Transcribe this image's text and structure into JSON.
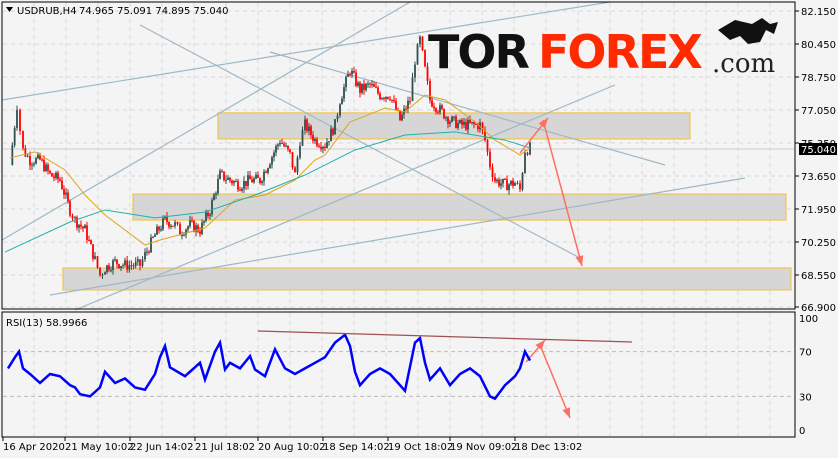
{
  "header": {
    "symbol_label": "USDRUB,H4",
    "ohlc": "74.965 75.091 74.895 75.040"
  },
  "logo": {
    "part1": "TOR",
    "part2": "FOREX",
    "part3": ".com"
  },
  "colors": {
    "bull_candle": "#2f4f4f",
    "bear_candle": "#ff0000",
    "ma_fast": "#daa520",
    "ma_slow": "#20b2aa",
    "zone_fill": "#d3d3d3",
    "zone_border": "#f0c040",
    "trendline": "#9fb8c8",
    "arrow": "#ff6f61",
    "rsi_line": "#0000ff",
    "rsi_trend": "#a05050"
  },
  "chart_data": [
    {
      "type": "candlestick",
      "title": "USDRUB,H4",
      "ylim": [
        66.9,
        82.15
      ],
      "y_ticks": [
        "82.150",
        "80.450",
        "78.750",
        "77.050",
        "75.350",
        "73.650",
        "71.950",
        "70.250",
        "68.550",
        "66.900"
      ],
      "current_price": "75.040",
      "x_ticks": [
        "16 Apr 2020",
        "21 May 10:02",
        "22 Jun 14:02",
        "21 Jul 18:02",
        "20 Aug 10:02",
        "18 Sep 14:02",
        "19 Oct 18:02",
        "19 Nov 09:02",
        "18 Dec 13:02"
      ],
      "close_series": [
        [
          1,
          74.22
        ],
        [
          2.4,
          77.31
        ],
        [
          3,
          76.02
        ],
        [
          3.6,
          74.99
        ],
        [
          5,
          74.47
        ],
        [
          7,
          74.47
        ],
        [
          9,
          73.7
        ],
        [
          11,
          73.44
        ],
        [
          13,
          71.9
        ],
        [
          14,
          71.38
        ],
        [
          16,
          70.87
        ],
        [
          18,
          69.32
        ],
        [
          19,
          68.55
        ],
        [
          20,
          68.91
        ],
        [
          22,
          69.22
        ],
        [
          24,
          69.06
        ],
        [
          27,
          69.06
        ],
        [
          28,
          69.58
        ],
        [
          30,
          70.61
        ],
        [
          32,
          71.38
        ],
        [
          34,
          71.13
        ],
        [
          35,
          70.76
        ],
        [
          37,
          71.13
        ],
        [
          39,
          70.87
        ],
        [
          41,
          71.9
        ],
        [
          43,
          73.7
        ],
        [
          45,
          73.44
        ],
        [
          47,
          73.19
        ],
        [
          49,
          73.44
        ],
        [
          51,
          73.44
        ],
        [
          53,
          74.47
        ],
        [
          55,
          75.5
        ],
        [
          57,
          74.73
        ],
        [
          58,
          73.7
        ],
        [
          59,
          75.5
        ],
        [
          60,
          76.28
        ],
        [
          62,
          75.5
        ],
        [
          64,
          75.25
        ],
        [
          66,
          76.28
        ],
        [
          67,
          77.57
        ],
        [
          69,
          79.11
        ],
        [
          71,
          78.08
        ],
        [
          73,
          78.34
        ],
        [
          75,
          77.82
        ],
        [
          77,
          77.82
        ],
        [
          79,
          76.53
        ],
        [
          81,
          77.57
        ],
        [
          82,
          79.63
        ],
        [
          83,
          80.66
        ],
        [
          84,
          79.11
        ],
        [
          85,
          77.57
        ],
        [
          87,
          77.05
        ],
        [
          89,
          76.53
        ],
        [
          91,
          76.28
        ],
        [
          93,
          76.28
        ],
        [
          95,
          76.28
        ],
        [
          96,
          75.5
        ],
        [
          97,
          74.22
        ],
        [
          98,
          73.44
        ],
        [
          100,
          73.19
        ],
        [
          102,
          73.29
        ],
        [
          103,
          72.93
        ],
        [
          104,
          74.99
        ],
        [
          105,
          75.09
        ]
      ],
      "ma_fast": [
        [
          1,
          74.58
        ],
        [
          6,
          74.89
        ],
        [
          12,
          73.96
        ],
        [
          16,
          72.67
        ],
        [
          20,
          71.64
        ],
        [
          28,
          70.09
        ],
        [
          31,
          70.35
        ],
        [
          40,
          70.97
        ],
        [
          46,
          72.41
        ],
        [
          52,
          72.67
        ],
        [
          58,
          73.44
        ],
        [
          62,
          74.47
        ],
        [
          64,
          74.73
        ],
        [
          69,
          76.43
        ],
        [
          76,
          77.15
        ],
        [
          80,
          76.95
        ],
        [
          84,
          77.82
        ],
        [
          88,
          77.57
        ],
        [
          94,
          76.43
        ],
        [
          98,
          75.5
        ],
        [
          103,
          74.73
        ],
        [
          105,
          75.09
        ]
      ],
      "ma_slow": [
        [
          0,
          69.73
        ],
        [
          13,
          71.28
        ],
        [
          20,
          71.9
        ],
        [
          30,
          71.49
        ],
        [
          40,
          71.79
        ],
        [
          50,
          72.67
        ],
        [
          60,
          73.7
        ],
        [
          70,
          74.99
        ],
        [
          80,
          75.76
        ],
        [
          90,
          75.92
        ],
        [
          100,
          75.5
        ],
        [
          105,
          75.09
        ]
      ],
      "zones": [
        {
          "from": 75.56,
          "to": 76.9
        },
        {
          "from": 71.38,
          "to": 72.72
        },
        {
          "from": 67.78,
          "to": 68.91
        }
      ]
    },
    {
      "type": "line",
      "title": "RSI(13) 58.9966",
      "ylim": [
        0,
        100
      ],
      "y_ticks": [
        "100",
        "70",
        "30",
        "0"
      ],
      "levels": [
        70,
        30
      ],
      "series": [
        [
          0.6,
          55
        ],
        [
          2,
          65
        ],
        [
          2.8,
          70
        ],
        [
          3.6,
          55
        ],
        [
          5,
          50
        ],
        [
          7,
          42
        ],
        [
          9,
          50
        ],
        [
          11,
          48
        ],
        [
          13,
          40
        ],
        [
          14,
          38
        ],
        [
          15,
          32
        ],
        [
          17,
          30
        ],
        [
          19,
          38
        ],
        [
          20,
          52
        ],
        [
          22,
          42
        ],
        [
          24,
          46
        ],
        [
          26,
          38
        ],
        [
          28,
          36
        ],
        [
          30,
          50
        ],
        [
          31,
          65
        ],
        [
          32,
          75
        ],
        [
          33,
          56
        ],
        [
          36,
          48
        ],
        [
          39,
          60
        ],
        [
          40,
          45
        ],
        [
          42,
          70
        ],
        [
          43,
          78
        ],
        [
          44,
          54
        ],
        [
          45,
          60
        ],
        [
          47,
          55
        ],
        [
          49,
          66
        ],
        [
          50,
          54
        ],
        [
          52,
          48
        ],
        [
          54,
          72
        ],
        [
          56,
          55
        ],
        [
          58,
          50
        ],
        [
          60,
          55
        ],
        [
          62,
          60
        ],
        [
          64,
          65
        ],
        [
          66,
          78
        ],
        [
          68,
          85
        ],
        [
          69,
          75
        ],
        [
          70,
          52
        ],
        [
          71,
          40
        ],
        [
          73,
          50
        ],
        [
          75,
          55
        ],
        [
          77,
          50
        ],
        [
          79,
          40
        ],
        [
          80,
          35
        ],
        [
          82,
          78
        ],
        [
          83,
          82
        ],
        [
          84,
          60
        ],
        [
          85,
          45
        ],
        [
          87,
          55
        ],
        [
          89,
          40
        ],
        [
          91,
          50
        ],
        [
          93,
          55
        ],
        [
          95,
          48
        ],
        [
          97,
          30
        ],
        [
          98,
          28
        ],
        [
          100,
          40
        ],
        [
          102,
          48
        ],
        [
          103,
          55
        ],
        [
          104,
          70
        ],
        [
          105,
          62
        ]
      ]
    }
  ]
}
